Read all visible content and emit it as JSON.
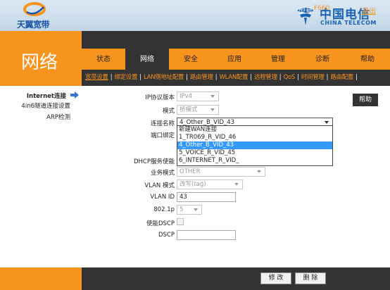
{
  "brand": {
    "name": "天翼宽带",
    "telecom_cn": "中国电信",
    "telecom_en": "CHINA TELECOM"
  },
  "header": {
    "model_label": "型号:",
    "model_value": "F660",
    "logout": "退出"
  },
  "section_title": "网络",
  "main_tabs": [
    {
      "label": "状态"
    },
    {
      "label": "网络"
    },
    {
      "label": "安全"
    },
    {
      "label": "应用"
    },
    {
      "label": "管理"
    },
    {
      "label": "诊断"
    },
    {
      "label": "帮助"
    }
  ],
  "sub_tabs": [
    {
      "label": "宽带设置"
    },
    {
      "label": "绑定设置"
    },
    {
      "label": "LAN侧地址配置"
    },
    {
      "label": "路由管理"
    },
    {
      "label": "WLAN配置"
    },
    {
      "label": "远程管理"
    },
    {
      "label": "QoS"
    },
    {
      "label": "时间管理"
    },
    {
      "label": "路由配置"
    }
  ],
  "side_menu": [
    {
      "label": "Internet连接"
    },
    {
      "label": "4in6隧道连接设置"
    },
    {
      "label": "ARP检测"
    }
  ],
  "form": {
    "ip_version": {
      "label": "IP协议版本",
      "value": "IPv4"
    },
    "mode": {
      "label": "模式",
      "value": "桥模式"
    },
    "conn_name": {
      "label": "连接名称",
      "value": "4_Other_B_VID_43",
      "options": [
        "新建WAN连接",
        "1_TR069_R_VID_46",
        "4_Other_B_VID_43",
        "5_VOICE_R_VID_45",
        "6_INTERNET_R_VID_"
      ],
      "selected_index": 2
    },
    "port_bind": {
      "label": "端口绑定"
    },
    "dhcp": {
      "label": "DHCP服务使能"
    },
    "service_mode": {
      "label": "业务模式",
      "value": "OTHER"
    },
    "vlan_mode": {
      "label": "VLAN 模式",
      "value": "改写(tag)"
    },
    "vlan_id": {
      "label": "VLAN ID",
      "value": "43"
    },
    "dot1p": {
      "label": "802.1p",
      "value": "5"
    },
    "dscp_enable": {
      "label": "使能DSCP"
    },
    "dscp": {
      "label": "DSCP",
      "value": ""
    }
  },
  "help_button": "帮助",
  "footer": {
    "save": "修 改",
    "delete": "删 除"
  },
  "colors": {
    "accent_orange": "#f7941d",
    "dark": "#333333",
    "selected_option": "#3399ff",
    "header_bg": "#c3d6e7"
  }
}
